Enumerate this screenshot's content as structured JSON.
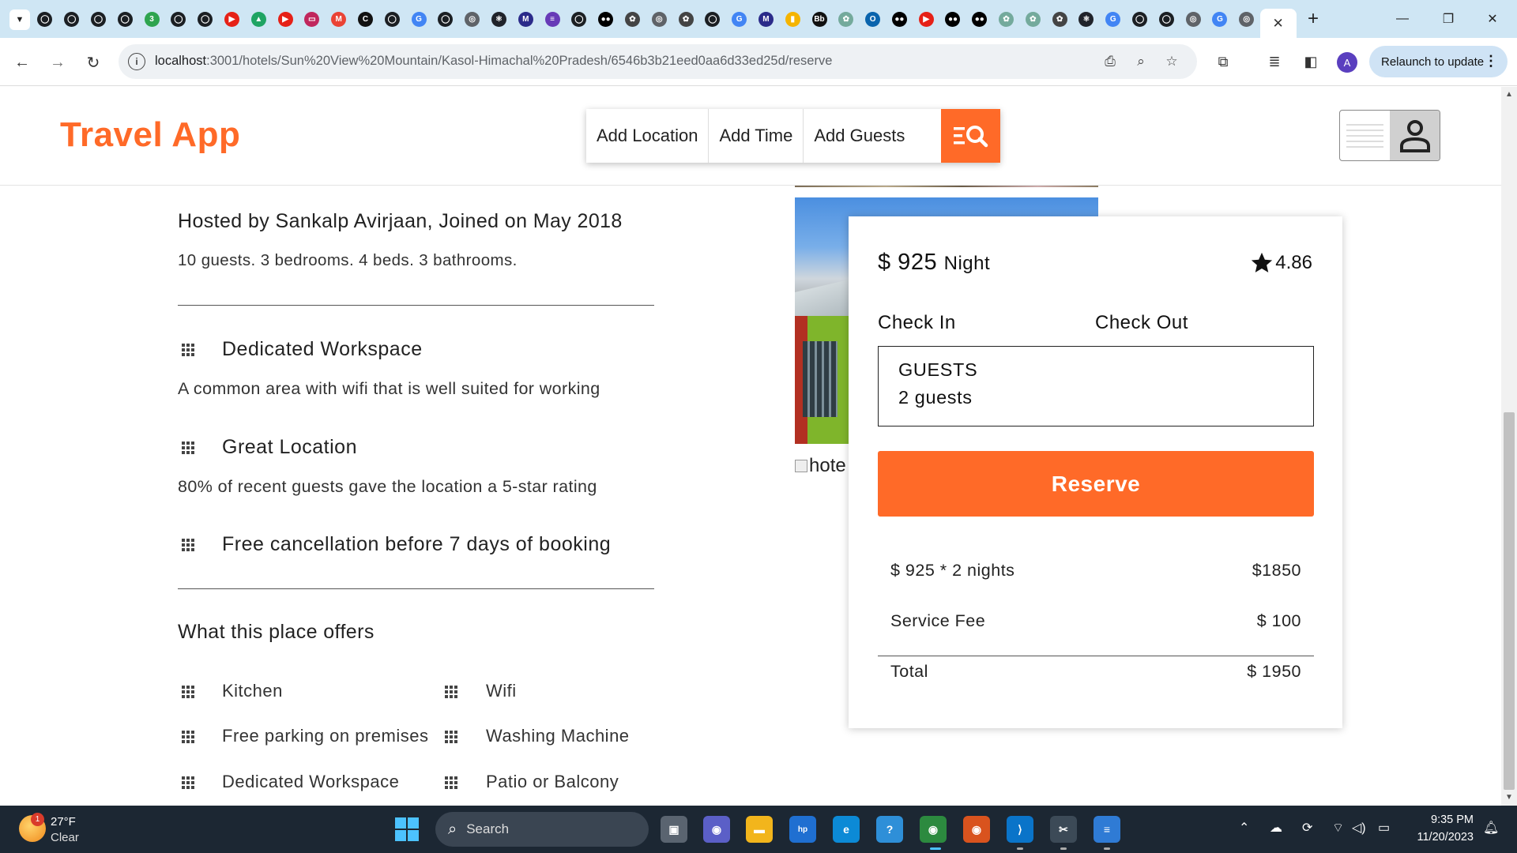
{
  "browser": {
    "active_tab_close": "✕",
    "new_tab": "+",
    "url_host": "localhost",
    "url_path": ":3001/hotels/Sun%20View%20Mountain/Kasol-Himachal%20Pradesh/6546b3b21eed0aa6d33ed25d/reserve",
    "relaunch_label": "Relaunch to update",
    "profile_initial": "A",
    "tab_favicons": [
      {
        "name": "github-icon",
        "glyph": "◯",
        "bg": "#1b1f23"
      },
      {
        "name": "github-icon",
        "glyph": "◯",
        "bg": "#1b1f23"
      },
      {
        "name": "github-icon",
        "glyph": "◯",
        "bg": "#1b1f23"
      },
      {
        "name": "github-icon",
        "glyph": "◯",
        "bg": "#1b1f23"
      },
      {
        "name": "badge-3-icon",
        "glyph": "3",
        "bg": "#2ea44f"
      },
      {
        "name": "github-icon",
        "glyph": "◯",
        "bg": "#1b1f23"
      },
      {
        "name": "github-icon",
        "glyph": "◯",
        "bg": "#1b1f23"
      },
      {
        "name": "youtube-icon",
        "glyph": "▶",
        "bg": "#e62117"
      },
      {
        "name": "drive-icon",
        "glyph": "▲",
        "bg": "#1fa463"
      },
      {
        "name": "youtube-icon",
        "glyph": "▶",
        "bg": "#e62117"
      },
      {
        "name": "app-icon",
        "glyph": "▭",
        "bg": "#c0275d"
      },
      {
        "name": "gmail-icon",
        "glyph": "M",
        "bg": "#ea4335"
      },
      {
        "name": "app-icon",
        "glyph": "C",
        "bg": "#111111"
      },
      {
        "name": "github-icon",
        "glyph": "◯",
        "bg": "#1b1f23"
      },
      {
        "name": "google-icon",
        "glyph": "G",
        "bg": "#4285f4"
      },
      {
        "name": "github-icon",
        "glyph": "◯",
        "bg": "#1b1f23"
      },
      {
        "name": "globe-icon",
        "glyph": "◎",
        "bg": "#5f6368"
      },
      {
        "name": "react-icon",
        "glyph": "⚛",
        "bg": "#20232a"
      },
      {
        "name": "app-icon",
        "glyph": "M",
        "bg": "#2b2b8a"
      },
      {
        "name": "forms-icon",
        "glyph": "≡",
        "bg": "#673ab7"
      },
      {
        "name": "github-icon",
        "glyph": "◯",
        "bg": "#1b1f23"
      },
      {
        "name": "medium-icon",
        "glyph": "●●",
        "bg": "#000000"
      },
      {
        "name": "chatgpt-icon",
        "glyph": "✿",
        "bg": "#444444"
      },
      {
        "name": "globe-icon",
        "glyph": "◎",
        "bg": "#5f6368"
      },
      {
        "name": "chatgpt-icon",
        "glyph": "✿",
        "bg": "#444444"
      },
      {
        "name": "github-icon",
        "glyph": "◯",
        "bg": "#1b1f23"
      },
      {
        "name": "google-icon",
        "glyph": "G",
        "bg": "#4285f4"
      },
      {
        "name": "app-icon",
        "glyph": "M",
        "bg": "#2b2b8a"
      },
      {
        "name": "chart-icon",
        "glyph": "▮",
        "bg": "#f5b400"
      },
      {
        "name": "app-icon",
        "glyph": "Bb",
        "bg": "#111111"
      },
      {
        "name": "chatgpt-icon",
        "glyph": "✿",
        "bg": "#74aa9c"
      },
      {
        "name": "outlook-icon",
        "glyph": "O",
        "bg": "#0a64ad"
      },
      {
        "name": "medium-icon",
        "glyph": "●●",
        "bg": "#000000"
      },
      {
        "name": "youtube-icon",
        "glyph": "▶",
        "bg": "#e62117"
      },
      {
        "name": "medium-icon",
        "glyph": "●●",
        "bg": "#000000"
      },
      {
        "name": "medium-icon",
        "glyph": "●●",
        "bg": "#000000"
      },
      {
        "name": "chatgpt-icon",
        "glyph": "✿",
        "bg": "#74aa9c"
      },
      {
        "name": "chatgpt-icon",
        "glyph": "✿",
        "bg": "#74aa9c"
      },
      {
        "name": "chatgpt-icon",
        "glyph": "✿",
        "bg": "#444444"
      },
      {
        "name": "react-icon",
        "glyph": "⚛",
        "bg": "#20232a"
      },
      {
        "name": "google-icon",
        "glyph": "G",
        "bg": "#4285f4"
      },
      {
        "name": "github-icon",
        "glyph": "◯",
        "bg": "#1b1f23"
      },
      {
        "name": "github-icon",
        "glyph": "◯",
        "bg": "#1b1f23"
      },
      {
        "name": "globe-icon",
        "glyph": "◎",
        "bg": "#5f6368"
      },
      {
        "name": "google-icon",
        "glyph": "G",
        "bg": "#4285f4"
      },
      {
        "name": "globe-icon",
        "glyph": "◎",
        "bg": "#5f6368"
      }
    ]
  },
  "app": {
    "logo": "Travel App",
    "brand_color": "#ff6a28",
    "search": {
      "location": "Add Location",
      "time": "Add Time",
      "guests": "Add Guests"
    }
  },
  "listing": {
    "host_line": "Hosted by Sankalp Avirjaan, Joined on May 2018",
    "specs": "10 guests. 3 bedrooms. 4 beds. 3 bathrooms.",
    "features": [
      {
        "title": "Dedicated Workspace",
        "desc": "A common area with wifi that is well suited for working"
      },
      {
        "title": "Great Location",
        "desc": "80% of recent guests gave the location a 5-star rating"
      },
      {
        "title": "Free cancellation before 7 days of booking",
        "desc": ""
      }
    ],
    "offers_title": "What this place offers",
    "offers": [
      "Kitchen",
      "Wifi",
      "Free parking on premises",
      "Washing Machine",
      "Dedicated Workspace",
      "Patio or Balcony"
    ],
    "broken_image_alt": "hote"
  },
  "reserve": {
    "price": "$ 925",
    "price_unit": "Night",
    "rating": "4.86",
    "check_in": "Check In",
    "check_out": "Check Out",
    "guests_label": "GUESTS",
    "guests_value": "2 guests",
    "button": "Reserve",
    "rows": [
      {
        "label": "$ 925 * 2 nights",
        "value": "$1850"
      },
      {
        "label": "Service Fee",
        "value": "$ 100"
      },
      {
        "label": "Total",
        "value": "$ 1950"
      }
    ]
  },
  "taskbar": {
    "weather_badge": "1",
    "temperature": "27°F",
    "condition": "Clear",
    "search_placeholder": "Search",
    "time": "9:35 PM",
    "date": "11/20/2023"
  }
}
